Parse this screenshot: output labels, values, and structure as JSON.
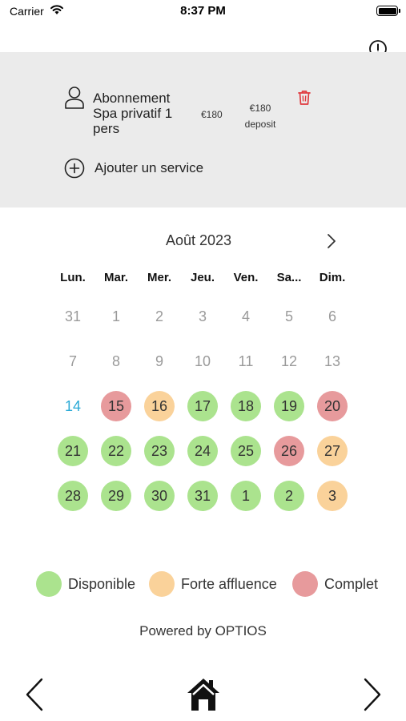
{
  "status_bar": {
    "carrier": "Carrier",
    "time": "8:37 PM"
  },
  "header_icons": [
    "info-icon",
    "account-icon"
  ],
  "service": {
    "name": "Abonnement Spa privatif 1 pers",
    "price": "€180",
    "deposit_amount": "€180",
    "deposit_label": "deposit",
    "add_label": "Ajouter un service"
  },
  "calendar": {
    "month": "Août 2023",
    "weekdays": [
      "Lun.",
      "Mar.",
      "Mer.",
      "Jeu.",
      "Ven.",
      "Sa...",
      "Dim."
    ],
    "weeks": [
      [
        {
          "day": "31",
          "status": "outside"
        },
        {
          "day": "1",
          "status": "past"
        },
        {
          "day": "2",
          "status": "past"
        },
        {
          "day": "3",
          "status": "past"
        },
        {
          "day": "4",
          "status": "past"
        },
        {
          "day": "5",
          "status": "past"
        },
        {
          "day": "6",
          "status": "past"
        }
      ],
      [
        {
          "day": "7",
          "status": "past"
        },
        {
          "day": "8",
          "status": "past"
        },
        {
          "day": "9",
          "status": "past"
        },
        {
          "day": "10",
          "status": "past"
        },
        {
          "day": "11",
          "status": "past"
        },
        {
          "day": "12",
          "status": "past"
        },
        {
          "day": "13",
          "status": "past"
        }
      ],
      [
        {
          "day": "14",
          "status": "today"
        },
        {
          "day": "15",
          "status": "full"
        },
        {
          "day": "16",
          "status": "busy"
        },
        {
          "day": "17",
          "status": "available"
        },
        {
          "day": "18",
          "status": "available"
        },
        {
          "day": "19",
          "status": "available"
        },
        {
          "day": "20",
          "status": "full"
        }
      ],
      [
        {
          "day": "21",
          "status": "available"
        },
        {
          "day": "22",
          "status": "available"
        },
        {
          "day": "23",
          "status": "available"
        },
        {
          "day": "24",
          "status": "available"
        },
        {
          "day": "25",
          "status": "available"
        },
        {
          "day": "26",
          "status": "full"
        },
        {
          "day": "27",
          "status": "busy"
        }
      ],
      [
        {
          "day": "28",
          "status": "available"
        },
        {
          "day": "29",
          "status": "available"
        },
        {
          "day": "30",
          "status": "available"
        },
        {
          "day": "31",
          "status": "available"
        },
        {
          "day": "1",
          "status": "available"
        },
        {
          "day": "2",
          "status": "available"
        },
        {
          "day": "3",
          "status": "busy"
        }
      ]
    ]
  },
  "legend": [
    {
      "label": "Disponible",
      "color": "#abe38e"
    },
    {
      "label": "Forte affluence",
      "color": "#fad29a"
    },
    {
      "label": "Complet",
      "color": "#e79a9c"
    }
  ],
  "footer": {
    "powered_by": "Powered by OPTIOS"
  },
  "colors": {
    "today": "#29a9d6",
    "trash": "#e0393e",
    "panel_bg": "#ebebeb"
  },
  "bottom_nav": [
    "back-arrow-icon",
    "home-icon",
    "forward-arrow-icon"
  ]
}
